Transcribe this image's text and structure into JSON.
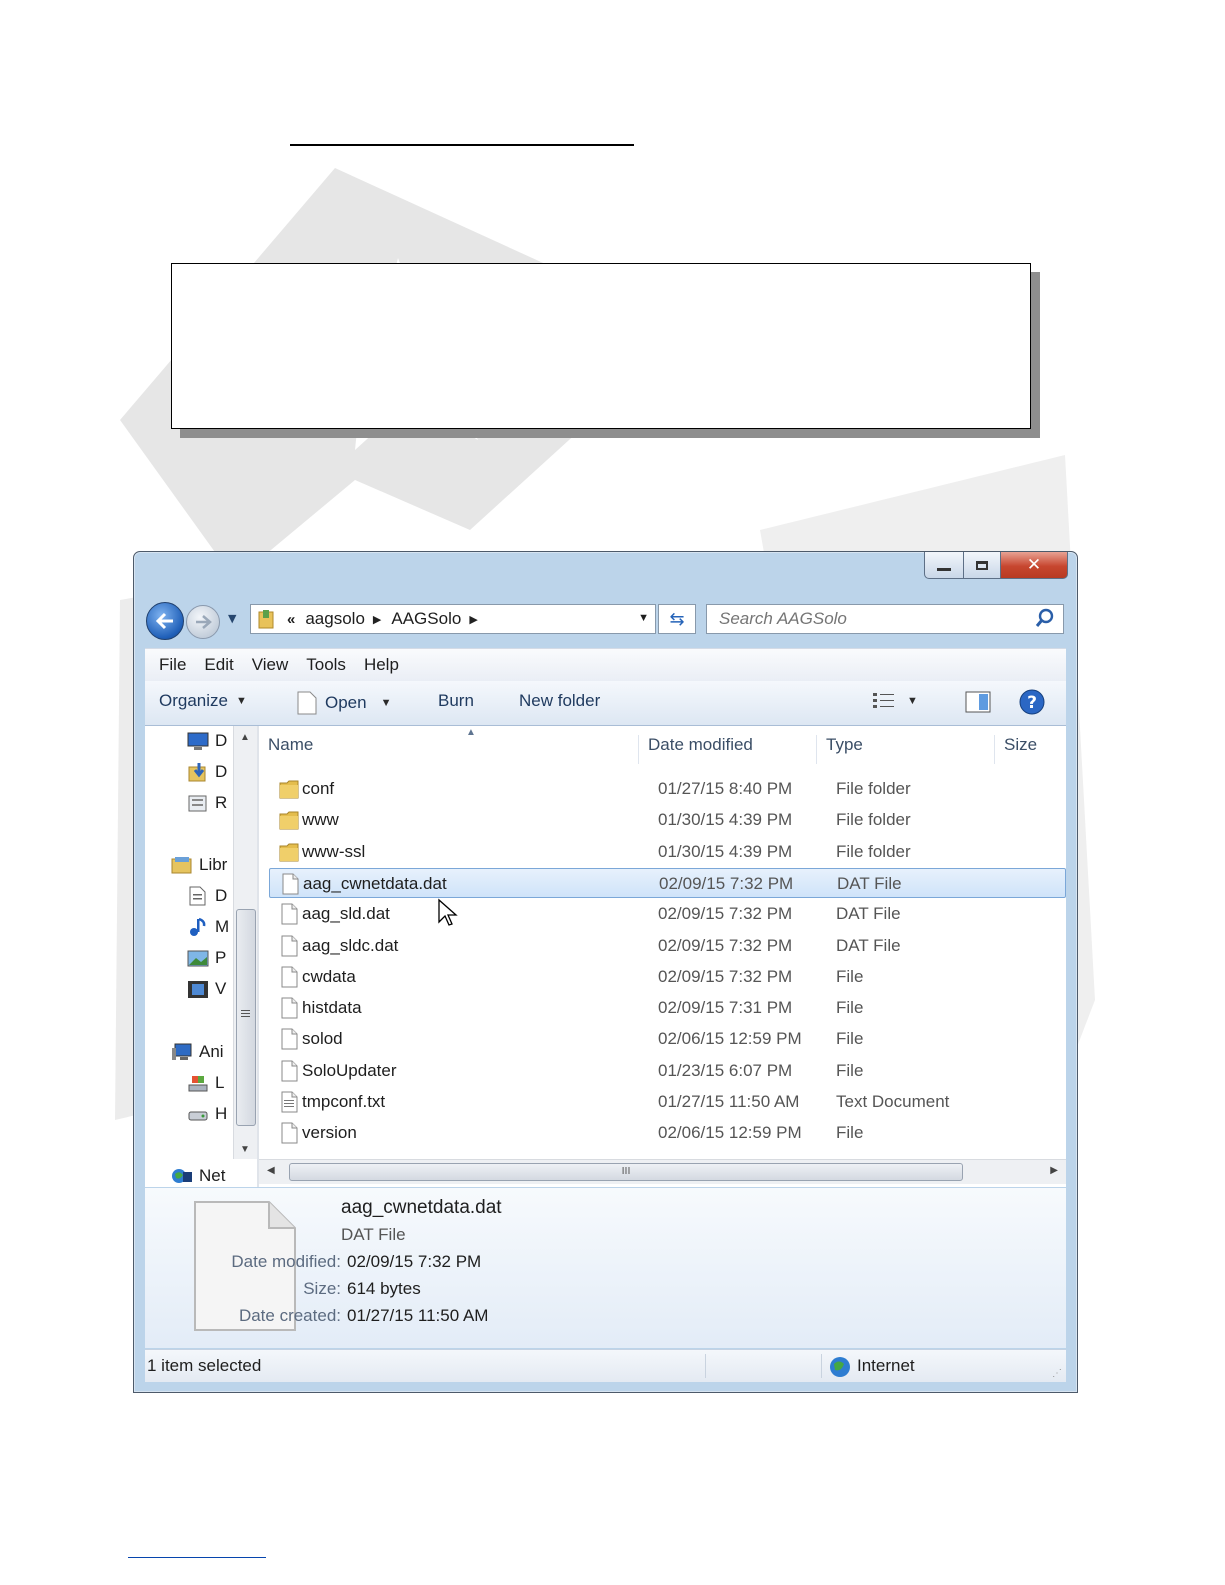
{
  "window": {
    "caption_buttons": [
      "minimize-icon",
      "maximize-icon",
      "close-icon"
    ]
  },
  "address_bar": {
    "overflow": "«",
    "crumbs": [
      "aagsolo",
      "AAGSolo"
    ]
  },
  "search": {
    "placeholder": "Search AAGSolo"
  },
  "menu": [
    "File",
    "Edit",
    "View",
    "Tools",
    "Help"
  ],
  "toolbar": {
    "organize": "Organize",
    "open": "Open",
    "burn": "Burn",
    "new_folder": "New folder"
  },
  "nav_pane": {
    "items": [
      {
        "icon": "desktop-icon",
        "label": "D"
      },
      {
        "icon": "downloads-icon",
        "label": "D"
      },
      {
        "icon": "recent-places-icon",
        "label": "R"
      },
      {
        "icon": "libraries-icon",
        "label": "Libr"
      },
      {
        "icon": "documents-icon",
        "label": "D"
      },
      {
        "icon": "music-icon",
        "label": "M"
      },
      {
        "icon": "pictures-icon",
        "label": "P"
      },
      {
        "icon": "videos-icon",
        "label": "V"
      },
      {
        "icon": "computer-icon",
        "label": "Ani"
      },
      {
        "icon": "local-disk-icon",
        "label": "L"
      },
      {
        "icon": "hard-drive-icon",
        "label": "H"
      },
      {
        "icon": "network-icon",
        "label": "Net"
      }
    ]
  },
  "columns": [
    "Name",
    "Date modified",
    "Type",
    "Size"
  ],
  "files": [
    {
      "name": "conf",
      "date": "01/27/15 8:40 PM",
      "type": "File folder",
      "icon": "folder-icon"
    },
    {
      "name": "www",
      "date": "01/30/15 4:39 PM",
      "type": "File folder",
      "icon": "folder-icon"
    },
    {
      "name": "www-ssl",
      "date": "01/30/15 4:39 PM",
      "type": "File folder",
      "icon": "folder-icon"
    },
    {
      "name": "aag_cwnetdata.dat",
      "date": "02/09/15 7:32 PM",
      "type": "DAT File",
      "icon": "file-icon",
      "selected": true
    },
    {
      "name": "aag_sld.dat",
      "date": "02/09/15 7:32 PM",
      "type": "DAT File",
      "icon": "file-icon"
    },
    {
      "name": "aag_sldc.dat",
      "date": "02/09/15 7:32 PM",
      "type": "DAT File",
      "icon": "file-icon"
    },
    {
      "name": "cwdata",
      "date": "02/09/15 7:32 PM",
      "type": "File",
      "icon": "file-icon"
    },
    {
      "name": "histdata",
      "date": "02/09/15 7:31 PM",
      "type": "File",
      "icon": "file-icon"
    },
    {
      "name": "solod",
      "date": "02/06/15 12:59 PM",
      "type": "File",
      "icon": "file-icon"
    },
    {
      "name": "SoloUpdater",
      "date": "01/23/15 6:07 PM",
      "type": "File",
      "icon": "file-icon"
    },
    {
      "name": "tmpconf.txt",
      "date": "01/27/15 11:50 AM",
      "type": "Text Document",
      "icon": "text-file-icon"
    },
    {
      "name": "version",
      "date": "02/06/15 12:59 PM",
      "type": "File",
      "icon": "file-icon"
    }
  ],
  "hscroll_grip": "III",
  "details": {
    "name": "aag_cwnetdata.dat",
    "type": "DAT File",
    "date_modified_label": "Date modified:",
    "date_modified": "02/09/15 7:32 PM",
    "size_label": "Size:",
    "size": "614 bytes",
    "date_created_label": "Date created:",
    "date_created": "01/27/15 11:50 AM"
  },
  "status": {
    "selection": "1 item selected",
    "zone": "Internet"
  }
}
